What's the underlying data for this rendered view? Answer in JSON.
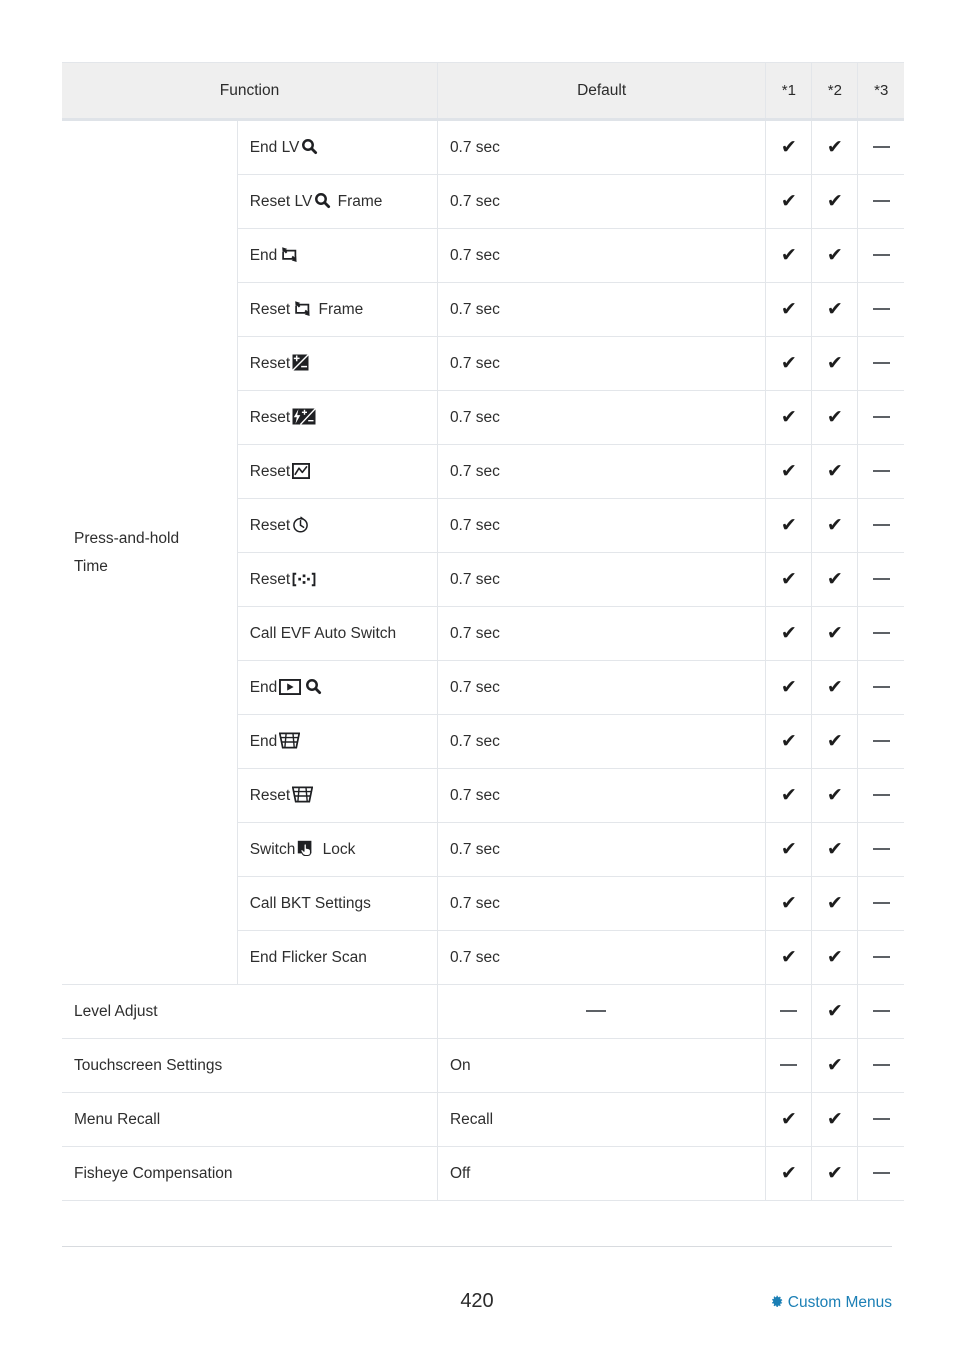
{
  "document": {
    "page_number": "420",
    "footer_link": "Custom Menus",
    "footer_icon": "gear-icon",
    "accent_color": "#1b7fb5"
  },
  "table": {
    "headers": {
      "function": "Function",
      "default": "Default",
      "star1": "*1",
      "star2": "*2",
      "star3": "*3"
    },
    "group_label": "Press-and-hold Time",
    "dash": "—",
    "check_glyph": "✔",
    "rows": [
      {
        "label_pre": "End LV",
        "icons": [
          "magnifier-icon"
        ],
        "label_post": "",
        "default": "0.7 sec",
        "s1": "check",
        "s2": "check",
        "s3": "dash"
      },
      {
        "label_pre": "Reset LV",
        "icons": [
          "magnifier-icon"
        ],
        "label_post": "Frame",
        "default": "0.7 sec",
        "s1": "check",
        "s2": "check",
        "s3": "dash"
      },
      {
        "label_pre": "End",
        "icons": [
          "frame-resize-icon"
        ],
        "label_post": "",
        "default": "0.7 sec",
        "s1": "check",
        "s2": "check",
        "s3": "dash"
      },
      {
        "label_pre": "Reset",
        "icons": [
          "frame-resize-icon"
        ],
        "label_post": "Frame",
        "default": "0.7 sec",
        "s1": "check",
        "s2": "check",
        "s3": "dash"
      },
      {
        "label_pre": "Reset",
        "icons": [
          "exposure-compensation-icon"
        ],
        "label_post": "",
        "default": "0.7 sec",
        "s1": "check",
        "s2": "check",
        "s3": "dash"
      },
      {
        "label_pre": "Reset",
        "icons": [
          "flash-compensation-icon"
        ],
        "label_post": "",
        "default": "0.7 sec",
        "s1": "check",
        "s2": "check",
        "s3": "dash"
      },
      {
        "label_pre": "Reset",
        "icons": [
          "highlight-shadow-curve-icon"
        ],
        "label_post": "",
        "default": "0.7 sec",
        "s1": "check",
        "s2": "check",
        "s3": "dash"
      },
      {
        "label_pre": "Reset",
        "icons": [
          "self-timer-icon"
        ],
        "label_post": "",
        "default": "0.7 sec",
        "s1": "check",
        "s2": "check",
        "s3": "dash"
      },
      {
        "label_pre": "Reset",
        "icons": [
          "af-target-icon"
        ],
        "label_post": "",
        "default": "0.7 sec",
        "s1": "check",
        "s2": "check",
        "s3": "dash"
      },
      {
        "label_pre": "Call EVF Auto Switch",
        "icons": [],
        "label_post": "",
        "default": "0.7 sec",
        "s1": "check",
        "s2": "check",
        "s3": "dash"
      },
      {
        "label_pre": "End",
        "icons": [
          "playback-icon",
          "magnifier-icon"
        ],
        "label_post": "",
        "default": "0.7 sec",
        "s1": "check",
        "s2": "check",
        "s3": "dash"
      },
      {
        "label_pre": "End",
        "icons": [
          "trash-basket-icon"
        ],
        "label_post": "",
        "default": "0.7 sec",
        "s1": "check",
        "s2": "check",
        "s3": "dash"
      },
      {
        "label_pre": "Reset",
        "icons": [
          "trash-basket-icon"
        ],
        "label_post": "",
        "default": "0.7 sec",
        "s1": "check",
        "s2": "check",
        "s3": "dash"
      },
      {
        "label_pre": "Switch",
        "icons": [
          "touch-lock-icon"
        ],
        "label_post": "Lock",
        "default": "0.7 sec",
        "s1": "check",
        "s2": "check",
        "s3": "dash"
      },
      {
        "label_pre": "Call BKT Settings",
        "icons": [],
        "label_post": "",
        "default": "0.7 sec",
        "s1": "check",
        "s2": "check",
        "s3": "dash"
      },
      {
        "label_pre": "End Flicker Scan",
        "icons": [],
        "label_post": "",
        "default": "0.7 sec",
        "s1": "check",
        "s2": "check",
        "s3": "dash"
      }
    ],
    "plain_rows": [
      {
        "label": "Level Adjust",
        "default": "—",
        "default_centered": true,
        "s1": "dash",
        "s2": "check",
        "s3": "dash"
      },
      {
        "label": "Touchscreen Settings",
        "default": "On",
        "default_centered": false,
        "s1": "dash",
        "s2": "check",
        "s3": "dash"
      },
      {
        "label": "Menu Recall",
        "default": "Recall",
        "default_centered": false,
        "s1": "check",
        "s2": "check",
        "s3": "dash"
      },
      {
        "label": "Fisheye Compensation",
        "default": "Off",
        "default_centered": false,
        "s1": "check",
        "s2": "check",
        "s3": "dash"
      }
    ]
  }
}
